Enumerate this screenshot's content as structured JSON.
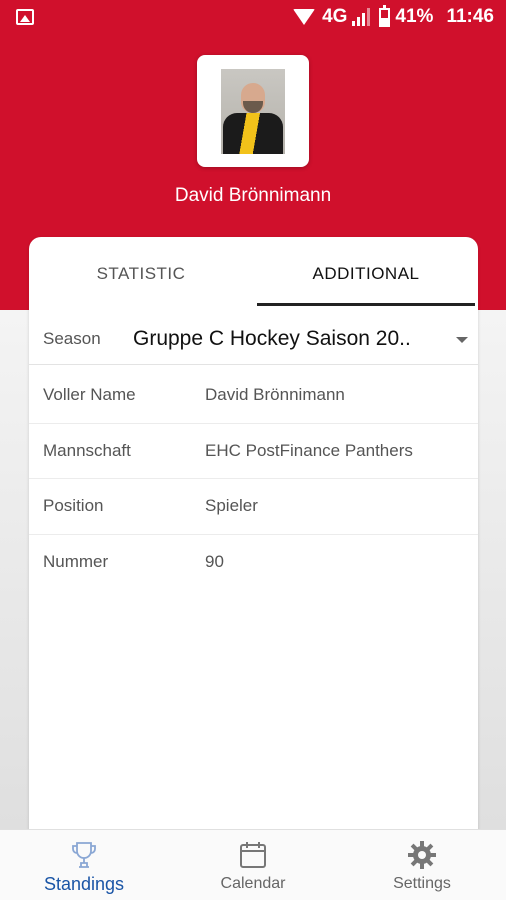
{
  "status_bar": {
    "network": "4G",
    "battery": "41%",
    "time": "11:46"
  },
  "profile": {
    "name": "David Brönnimann"
  },
  "tabs": [
    {
      "label": "STATISTIC",
      "active": false
    },
    {
      "label": "ADDITIONAL",
      "active": true
    }
  ],
  "season": {
    "label": "Season",
    "value": "Gruppe C Hockey Saison 20.."
  },
  "details": [
    {
      "label": "Voller Name",
      "value": "David Brönnimann"
    },
    {
      "label": "Mannschaft",
      "value": "EHC PostFinance Panthers"
    },
    {
      "label": "Position",
      "value": "Spieler"
    },
    {
      "label": "Nummer",
      "value": "90"
    }
  ],
  "nav": [
    {
      "label": "Standings",
      "icon": "trophy-icon",
      "active": true
    },
    {
      "label": "Calendar",
      "icon": "calendar-icon",
      "active": false
    },
    {
      "label": "Settings",
      "icon": "gear-icon",
      "active": false
    }
  ],
  "colors": {
    "header": "#d0102c",
    "active_nav": "#1a55a6"
  }
}
